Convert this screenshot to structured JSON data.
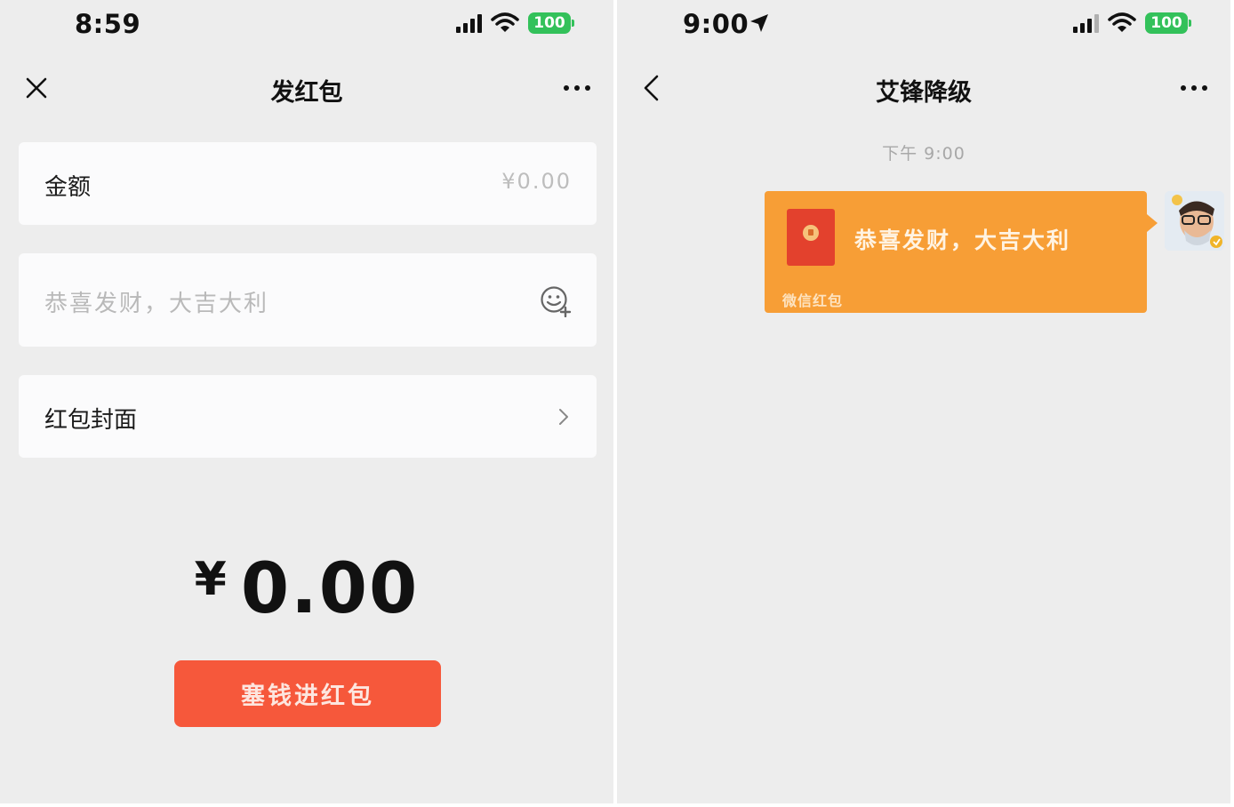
{
  "left_screen": {
    "status_bar": {
      "time": "8:59",
      "battery": "100"
    },
    "nav": {
      "title": "发红包"
    },
    "amount": {
      "label": "金额",
      "placeholder": "¥0.00"
    },
    "greeting": {
      "placeholder": "恭喜发财，大吉大利"
    },
    "cover": {
      "label": "红包封面"
    },
    "total": {
      "currency": "¥",
      "value": "0.00"
    },
    "send_button": {
      "label": "塞钱进红包"
    }
  },
  "right_screen": {
    "status_bar": {
      "time": "9:00",
      "battery": "100"
    },
    "nav": {
      "title": "艾锋降级"
    },
    "chat": {
      "timestamp": "下午 9:00",
      "red_packet": {
        "message": "恭喜发财，大吉大利",
        "footer": "微信红包"
      }
    }
  },
  "colors": {
    "screen_background": "#ededed",
    "card_background": "#fbfbfc",
    "send_button": "#f6583b",
    "red_packet_bubble": "#f79e36",
    "red_packet_icon": "#e3412d",
    "battery": "#33c15a"
  },
  "icons": [
    "close-icon",
    "more-icon",
    "back-icon",
    "emoji-add-icon",
    "chevron-right-icon",
    "location-arrow-icon",
    "wifi-icon",
    "signal-icon"
  ]
}
